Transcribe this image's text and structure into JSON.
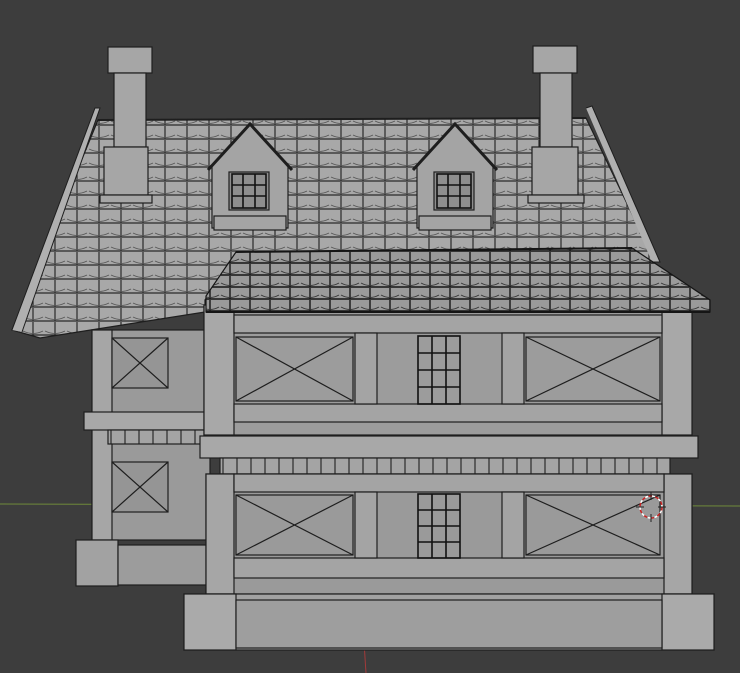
{
  "scene": {
    "subject": "half-timbered-house-3d-model",
    "view": "front-orthographic-solid-wireframe",
    "viewport_background": "#3d3d3d",
    "model_fill": "#9c9c9c",
    "edge_color": "#1e1e1e",
    "x_axis_color": "#6f8a3a",
    "y_axis_color": "#a33a3a",
    "cursor_color": "#cc2222"
  }
}
